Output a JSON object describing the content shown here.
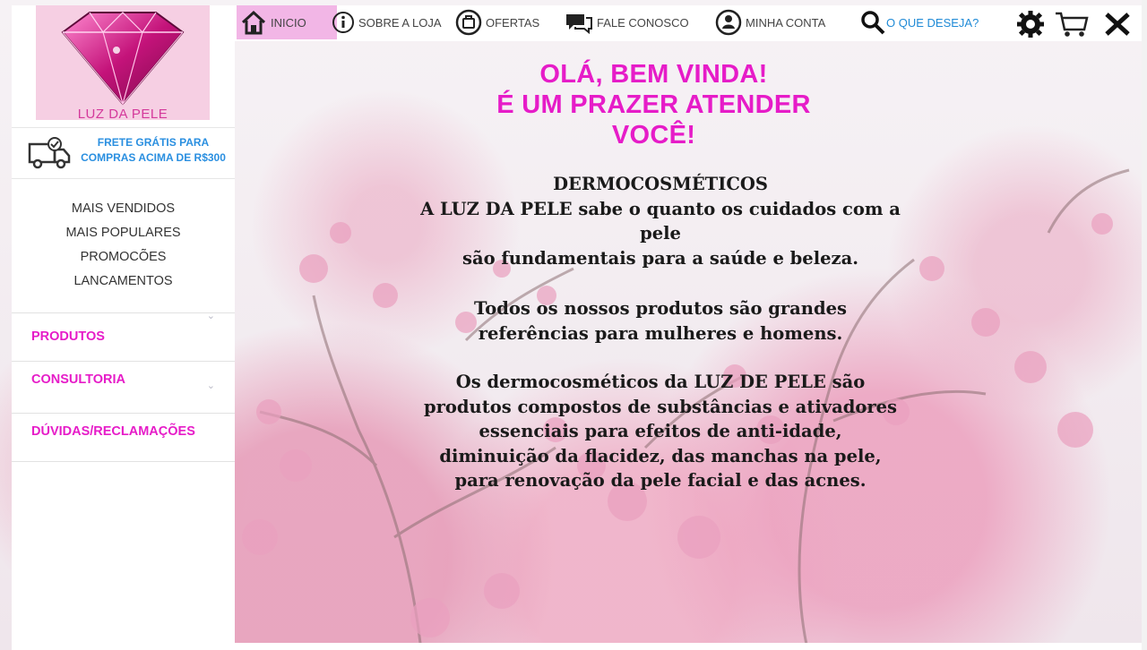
{
  "brand": {
    "logo_text": "LUZ DA PELE"
  },
  "shipping": {
    "text": "FRETE GRÁTIS PARA COMPRAS ACIMA DE R$300",
    "icon": "truck-check-icon"
  },
  "quick_links": [
    "MAIS VENDIDOS",
    "MAIS POPULARES",
    "PROMOCÕES",
    "LANCAMENTOS"
  ],
  "categories": [
    {
      "label": "PRODUTOS",
      "icon": "chevron-down-icon"
    },
    {
      "label": "CONSULTORIA",
      "icon": "chevron-down-icon"
    },
    {
      "label": "DÚVIDAS/RECLAMAÇÕES"
    }
  ],
  "nav": {
    "home": "INICIO",
    "about": "SOBRE A LOJA",
    "offers": "OFERTAS",
    "contact": "FALE CONOSCO",
    "account": "MINHA CONTA",
    "search": "O QUE DESEJA?"
  },
  "welcome": {
    "line1": "OLÁ, BEM VINDA!",
    "line2": "É UM PRAZER ATENDER",
    "line3": "VOCÊ!"
  },
  "intro": {
    "p1": [
      "DERMOCOSMÉTICOS",
      "A LUZ DA PELE sabe o quanto os cuidados com a",
      "pele",
      "são fundamentais para a saúde e beleza."
    ],
    "p2": [
      "Todos os nossos produtos são grandes",
      "referências para mulheres e homens."
    ],
    "p3": [
      "Os dermocosméticos da LUZ DE PELE são",
      "produtos compostos de substâncias e ativadores",
      "essenciais para efeitos de anti-idade,",
      "diminuição da flacidez, das manchas na pele,",
      "para renovação da pele facial e das acnes."
    ]
  },
  "colors": {
    "accent": "#e61cc8",
    "link": "#1f8ad6",
    "active_tab": "#f2b6e6"
  }
}
